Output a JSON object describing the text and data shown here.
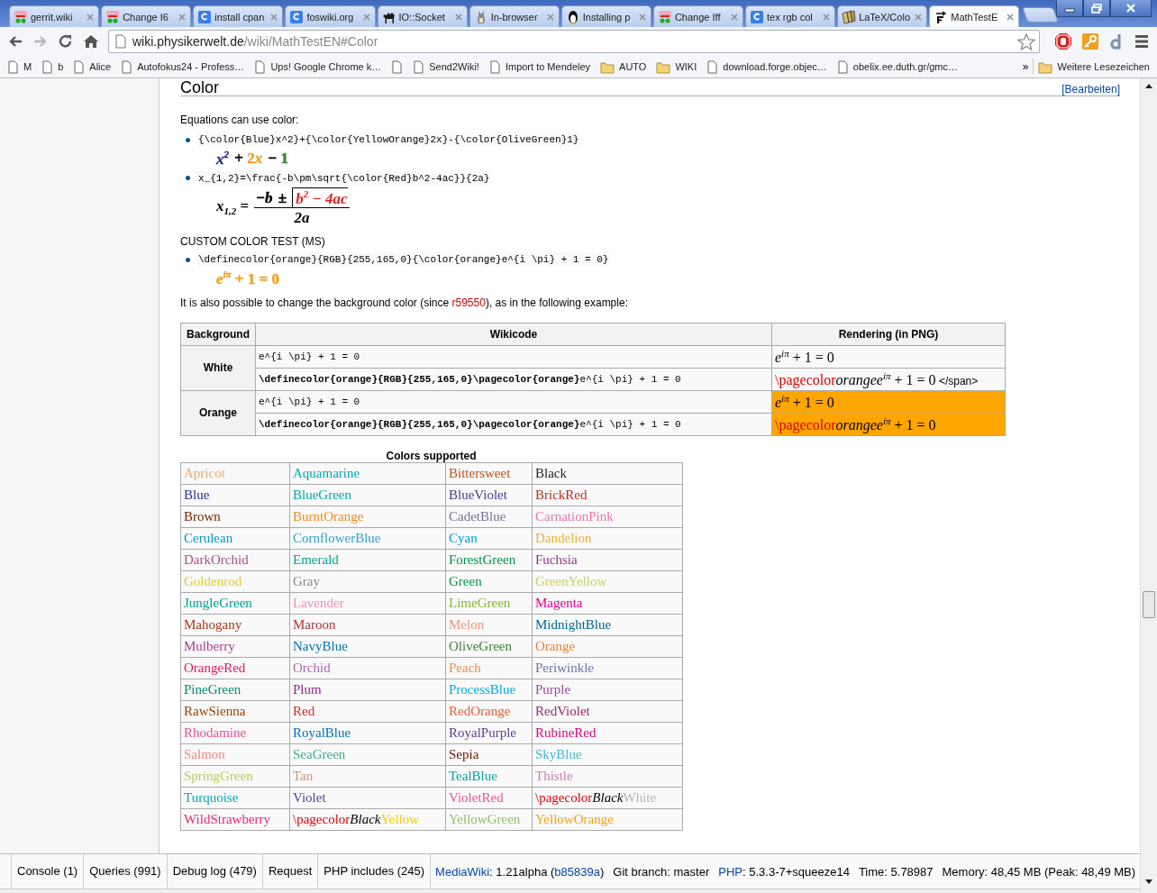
{
  "browser": {
    "tabs": [
      {
        "title": "gerrit.wiki",
        "kind": "gerrit",
        "selected": false
      },
      {
        "title": "Change I6",
        "kind": "gerrit",
        "selected": false
      },
      {
        "title": "install cpan",
        "kind": "google",
        "selected": false
      },
      {
        "title": "foswiki.org",
        "kind": "google",
        "selected": false
      },
      {
        "title": "IO::Socket",
        "kind": "camel",
        "selected": false
      },
      {
        "title": "In-browser",
        "kind": "cat",
        "selected": false
      },
      {
        "title": "Installing p",
        "kind": "penguin",
        "selected": false
      },
      {
        "title": "Change Iff",
        "kind": "gerrit",
        "selected": false
      },
      {
        "title": "tex rgb col",
        "kind": "google",
        "selected": false
      },
      {
        "title": "LaTeX/Colo",
        "kind": "book",
        "selected": false
      },
      {
        "title": "MathTestE",
        "kind": "vector",
        "selected": true
      }
    ],
    "address": {
      "host": "wiki.physikerwelt.de",
      "path": "/wiki/MathTestEN#Color"
    },
    "bookmarks": [
      {
        "label": "M",
        "kind": "page"
      },
      {
        "label": "b",
        "kind": "page"
      },
      {
        "label": "Alice",
        "kind": "page"
      },
      {
        "label": "Autofokus24 - Profess…",
        "kind": "page"
      },
      {
        "label": "Ups! Google Chrome k…",
        "kind": "page"
      },
      {
        "kind": "page"
      },
      {
        "label": "Send2Wiki!",
        "kind": "page"
      },
      {
        "label": "Import to Mendeley",
        "kind": "page"
      },
      {
        "label": "AUTO",
        "kind": "folder"
      },
      {
        "label": "WIKI",
        "kind": "folder"
      },
      {
        "label": "download.forge.objec…",
        "kind": "page"
      },
      {
        "label": "obelix.ee.duth.gr/gmc…",
        "kind": "page"
      }
    ],
    "more_bookmarks": "»",
    "other_bookmarks": "Weitere Lesezeichen"
  },
  "page": {
    "heading": "Color",
    "edit_link": "[Bearbeiten]",
    "intro": "Equations can use color:",
    "equations": [
      {
        "code": "{\\color{Blue}x^2}+{\\color{YellowOrange}2x}-{\\color{OliveGreen}1}",
        "rendering": {
          "kind": "inline",
          "parts": [
            {
              "text": "x$^{2}$",
              "color": "#2d2f92",
              "italic": true
            },
            {
              "text": " + ",
              "color": "#000000",
              "italic": false
            },
            {
              "text": "2",
              "color": "#f0a020",
              "italic": false
            },
            {
              "text": "x",
              "color": "#f0a020",
              "italic": true
            },
            {
              "text": " − ",
              "color": "#000000",
              "italic": false
            },
            {
              "text": "1",
              "color": "#3c8031",
              "italic": false
            }
          ]
        }
      },
      {
        "code": "x_{1,2}=\\frac{-b\\pm\\sqrt{\\color{Red}b^2-4ac}}{2a}",
        "rendering": {
          "kind": "fraction",
          "lhs": "*x*$_{1,2}$ =",
          "numerator": [
            {
              "text": "−",
              "color": "#000000",
              "italic": false,
              "radical": false
            },
            {
              "text": "b",
              "color": "#000000",
              "italic": true,
              "radical": false
            },
            {
              "text": " ± ",
              "color": "#000000",
              "italic": false,
              "radical": false
            },
            {
              "text": "b$^{2}$ − 4ac",
              "color": "#e2211c",
              "italic": true,
              "radical": true
            }
          ],
          "denominator": "2a"
        }
      }
    ],
    "custom_heading": "CUSTOM COLOR TEST (MS)",
    "custom_equations": [
      {
        "code": "\\definecolor{orange}{RGB}{255,165,0}{\\color{orange}e^{i \\pi} + 1 = 0}",
        "rendering": {
          "kind": "inline",
          "parts": [
            {
              "text": "*e*$^{iπ}$ + 1 = 0",
              "color": "#f0a020",
              "italic": false
            }
          ]
        }
      }
    ],
    "background_paragraph": [
      {
        "text": "It is also possible to change the background color (since ",
        "link": false
      },
      {
        "text": "r59550",
        "link": true
      },
      {
        "text": "), as in the following example:",
        "link": false
      }
    ],
    "wikicode_table": {
      "columns": [
        "Background",
        "Wikicode",
        "Rendering (in PNG)"
      ],
      "rows": [
        {
          "background": "White",
          "lines": [
            {
              "code": "e^{i \\pi} + 1 = 0",
              "rendering": [
                {
                  "text": "*e*$^{iπ}$ + 1 = 0",
                  "color": "#000000"
                }
              ],
              "highlighted": false
            },
            {
              "code": "**\\definecolor{orange}{RGB}{255,165,0}\\pagecolor{orange}**e^{i \\pi} + 1 = 0",
              "rendering": [
                {
                  "text": "\\pagecolor",
                  "color": "#e00000"
                },
                {
                  "text": "*orangee*$^{iπ}$ + 1 = 0",
                  "color": "#000000"
                }
              ],
              "note": "</span>",
              "highlighted": false
            }
          ]
        },
        {
          "background": "Orange",
          "lines": [
            {
              "code": "e^{i \\pi} + 1 = 0",
              "rendering": [
                {
                  "text": "*e*$^{iπ}$ + 1 = 0",
                  "color": "#000000"
                }
              ],
              "highlighted": true
            },
            {
              "code": "**\\definecolor{orange}{RGB}{255,165,0}\\pagecolor{orange}**e^{i \\pi} + 1 = 0",
              "rendering": [
                {
                  "text": "\\pagecolor",
                  "color": "#e00000"
                },
                {
                  "text": "*orangee*$^{iπ}$ + 1 = 0",
                  "color": "#000000"
                }
              ],
              "highlighted": true
            }
          ]
        }
      ]
    },
    "colors_table": {
      "caption": "Colors supported",
      "rows": [
        [
          {
            "text": "Apricot",
            "color": "#f0a870"
          },
          {
            "text": "Aquamarine",
            "color": "#00a8b0"
          },
          {
            "text": "Bittersweet",
            "color": "#c04f17"
          },
          {
            "text": "Black",
            "color": "#221e1f"
          }
        ],
        [
          {
            "text": "Blue",
            "color": "#2d2f92"
          },
          {
            "text": "BlueGreen",
            "color": "#00a8b0"
          },
          {
            "text": "BlueViolet",
            "color": "#473992"
          },
          {
            "text": "BrickRed",
            "color": "#b6321c"
          }
        ],
        [
          {
            "text": "Brown",
            "color": "#792500"
          },
          {
            "text": "BurntOrange",
            "color": "#f08a1d"
          },
          {
            "text": "CadetBlue",
            "color": "#74729a"
          },
          {
            "text": "CarnationPink",
            "color": "#ea74a8"
          }
        ],
        [
          {
            "text": "Cerulean",
            "color": "#0098d0"
          },
          {
            "text": "CornflowerBlue",
            "color": "#30a0d0"
          },
          {
            "text": "Cyan",
            "color": "#00a0e0"
          },
          {
            "text": "Dandelion",
            "color": "#f0b030"
          }
        ],
        [
          {
            "text": "DarkOrchid",
            "color": "#a4538a"
          },
          {
            "text": "Emerald",
            "color": "#00a090"
          },
          {
            "text": "ForestGreen",
            "color": "#009050"
          },
          {
            "text": "Fuchsia",
            "color": "#8c368c"
          }
        ],
        [
          {
            "text": "Goldenrod",
            "color": "#e8c830"
          },
          {
            "text": "Gray",
            "color": "#888a8c"
          },
          {
            "text": "Green",
            "color": "#00984a"
          },
          {
            "text": "GreenYellow",
            "color": "#c8d060"
          }
        ],
        [
          {
            "text": "JungleGreen",
            "color": "#00a090"
          },
          {
            "text": "Lavender",
            "color": "#ee90b8"
          },
          {
            "text": "LimeGreen",
            "color": "#80b838"
          },
          {
            "text": "Magenta",
            "color": "#e0008a"
          }
        ],
        [
          {
            "text": "Mahogany",
            "color": "#a9341f"
          },
          {
            "text": "Maroon",
            "color": "#af3235"
          },
          {
            "text": "Melon",
            "color": "#f09478"
          },
          {
            "text": "MidnightBlue",
            "color": "#006795"
          }
        ],
        [
          {
            "text": "Mulberry",
            "color": "#a93c93"
          },
          {
            "text": "NavyBlue",
            "color": "#006eb8"
          },
          {
            "text": "OliveGreen",
            "color": "#3c8031"
          },
          {
            "text": "Orange",
            "color": "#f07a30"
          }
        ],
        [
          {
            "text": "OrangeRed",
            "color": "#ed135a"
          },
          {
            "text": "Orchid",
            "color": "#a86aa8"
          },
          {
            "text": "Peach",
            "color": "#f08c50"
          },
          {
            "text": "Periwinkle",
            "color": "#7270b0"
          }
        ],
        [
          {
            "text": "PineGreen",
            "color": "#008b72"
          },
          {
            "text": "Plum",
            "color": "#92268f"
          },
          {
            "text": "ProcessBlue",
            "color": "#00a8e8"
          },
          {
            "text": "Purple",
            "color": "#99479b"
          }
        ],
        [
          {
            "text": "RawSienna",
            "color": "#974006"
          },
          {
            "text": "Red",
            "color": "#e2211c"
          },
          {
            "text": "RedOrange",
            "color": "#f05a30"
          },
          {
            "text": "RedViolet",
            "color": "#a1246b"
          }
        ],
        [
          {
            "text": "Rhodamine",
            "color": "#e84c98"
          },
          {
            "text": "RoyalBlue",
            "color": "#0071bc"
          },
          {
            "text": "RoyalPurple",
            "color": "#613f99"
          },
          {
            "text": "RubineRed",
            "color": "#e0017a"
          }
        ],
        [
          {
            "text": "Salmon",
            "color": "#f08880"
          },
          {
            "text": "SeaGreen",
            "color": "#38b090"
          },
          {
            "text": "Sepia",
            "color": "#671800"
          },
          {
            "text": "SkyBlue",
            "color": "#40b8d0"
          }
        ],
        [
          {
            "text": "SpringGreen",
            "color": "#b8cc58"
          },
          {
            "text": "Tan",
            "color": "#d09470"
          },
          {
            "text": "TealBlue",
            "color": "#00a4a8"
          },
          {
            "text": "Thistle",
            "color": "#d07cac"
          }
        ],
        [
          {
            "text": "Turquoise",
            "color": "#00a8c0"
          },
          {
            "text": "Violet",
            "color": "#58429b"
          },
          {
            "text": "VioletRed",
            "color": "#ea5098"
          },
          {
            "parts": [
              {
                "text": "\\pagecolor",
                "color": "#e00000",
                "italic": false
              },
              {
                "text": "Black",
                "color": "#000000",
                "italic": true
              },
              {
                "text": "White",
                "color": "#b4b4b4",
                "italic": false
              }
            ]
          }
        ],
        [
          {
            "text": "WildStrawberry",
            "color": "#ee2967"
          },
          {
            "parts": [
              {
                "text": "\\pagecolor",
                "color": "#e00000",
                "italic": false
              },
              {
                "text": "Black",
                "color": "#000000",
                "italic": true
              },
              {
                "text": "Yellow",
                "color": "#f0d000",
                "italic": false
              }
            ]
          },
          {
            "text": "YellowGreen",
            "color": "#90c068"
          },
          {
            "text": "YellowOrange",
            "color": "#f5a01a"
          }
        ]
      ]
    }
  },
  "debug_bar": {
    "tabs": [
      "Console (1)",
      "Queries (991)",
      "Debug log (479)",
      "Request",
      "PHP includes (245)"
    ],
    "info": [
      [
        {
          "text": "MediaWiki",
          "link": true
        },
        {
          "text": ": 1.21alpha (",
          "link": false
        },
        {
          "text": "b85839a",
          "link": true
        },
        {
          "text": ")",
          "link": false
        }
      ],
      [
        {
          "text": "Git branch: master",
          "link": false
        }
      ],
      [
        {
          "text": "PHP",
          "link": true
        },
        {
          "text": ": 5.3.3-7+squeeze14",
          "link": false
        }
      ],
      [
        {
          "text": "Time: 5.78987",
          "link": false
        }
      ],
      [
        {
          "text": "Memory: 48,45 MB (Peak: 48,49 MB)",
          "link": false
        }
      ]
    ]
  }
}
